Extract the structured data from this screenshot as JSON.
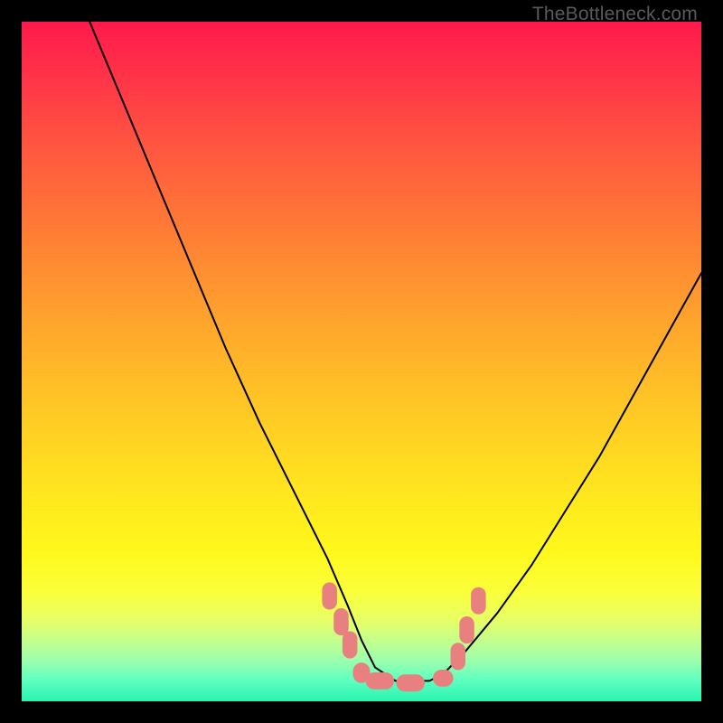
{
  "watermark": "TheBottleneck.com",
  "chart_data": {
    "type": "line",
    "title": "",
    "xlabel": "",
    "ylabel": "",
    "xlim": [
      0,
      100
    ],
    "ylim": [
      0,
      100
    ],
    "grid": false,
    "legend": false,
    "series": [
      {
        "name": "bottleneck-curve",
        "x": [
          10,
          15,
          20,
          25,
          30,
          35,
          40,
          45,
          48,
          50,
          52,
          55,
          58,
          60,
          62,
          65,
          70,
          75,
          80,
          85,
          90,
          95,
          100
        ],
        "y": [
          100,
          88,
          76,
          64,
          52,
          41,
          31,
          21,
          14,
          9,
          5,
          3,
          3,
          3,
          4,
          7,
          13,
          20,
          28,
          36,
          45,
          54,
          63
        ],
        "color": "#000000",
        "width": 2
      }
    ],
    "markers": [
      {
        "name": "valley-markers",
        "shape": "rounded-rect",
        "color": "#e98080",
        "points": [
          {
            "x": 45.3,
            "y": 15.5,
            "w": 2.2,
            "h": 4.0
          },
          {
            "x": 47.0,
            "y": 11.7,
            "w": 2.2,
            "h": 4.0
          },
          {
            "x": 48.3,
            "y": 8.3,
            "w": 2.2,
            "h": 4.0
          },
          {
            "x": 50.0,
            "y": 4.2,
            "w": 2.5,
            "h": 3.0
          },
          {
            "x": 52.7,
            "y": 3.0,
            "w": 4.2,
            "h": 2.5
          },
          {
            "x": 57.2,
            "y": 2.7,
            "w": 4.2,
            "h": 2.5
          },
          {
            "x": 62.0,
            "y": 3.4,
            "w": 3.0,
            "h": 2.5
          },
          {
            "x": 64.2,
            "y": 6.6,
            "w": 2.2,
            "h": 4.0
          },
          {
            "x": 65.5,
            "y": 10.5,
            "w": 2.2,
            "h": 4.0
          },
          {
            "x": 67.2,
            "y": 14.8,
            "w": 2.2,
            "h": 4.0
          }
        ]
      }
    ]
  }
}
